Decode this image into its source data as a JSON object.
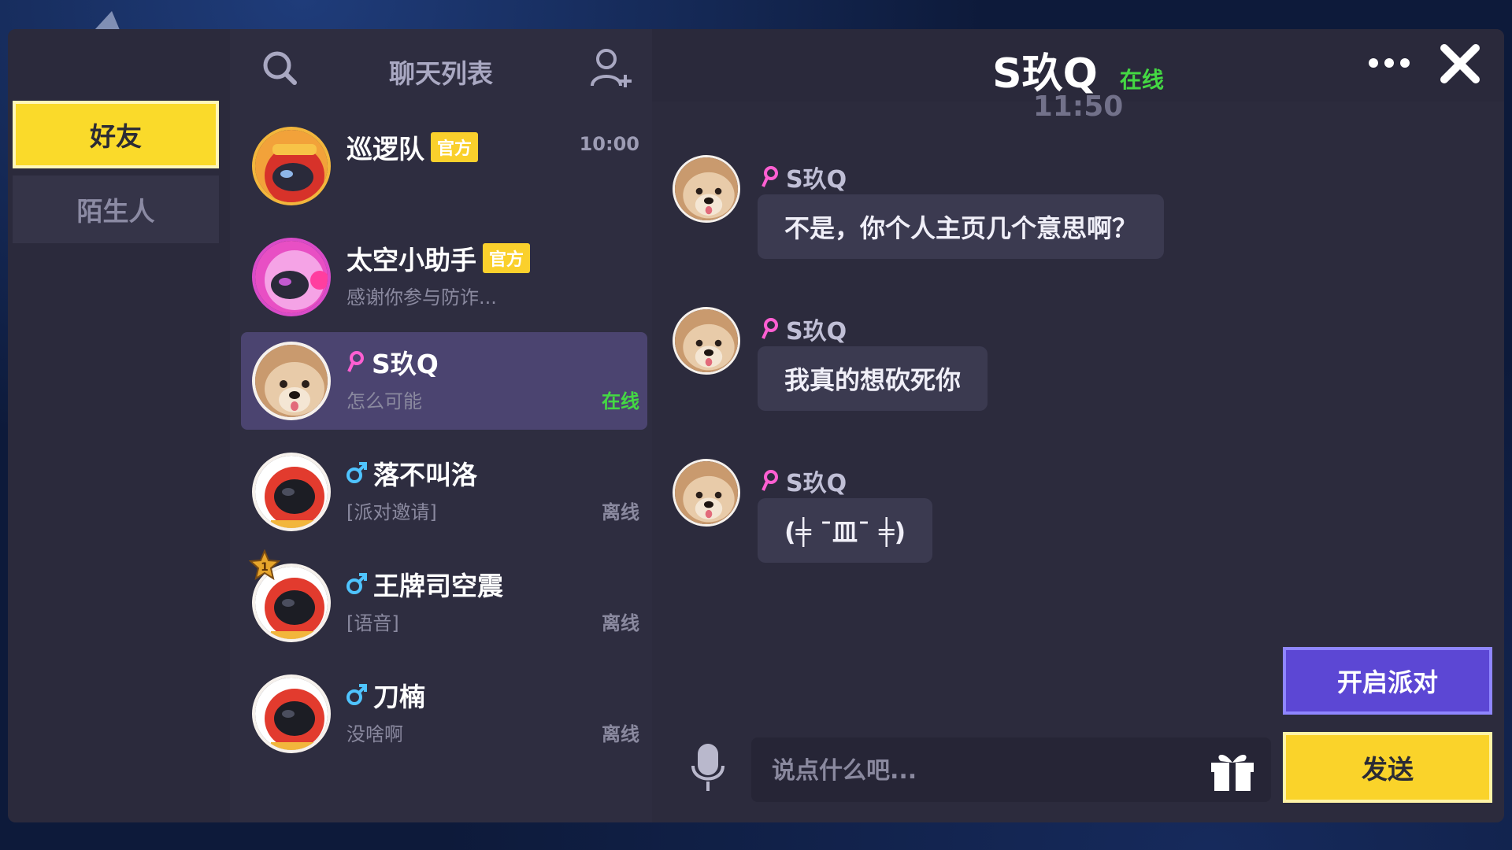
{
  "category": {
    "friends": "好友",
    "strangers": "陌生人"
  },
  "list_header": {
    "title": "聊天列表"
  },
  "chats": [
    {
      "name": "巡逻队",
      "badge": "官方",
      "preview": "",
      "meta": "10:00"
    },
    {
      "name": "太空小助手",
      "badge": "官方",
      "preview": "感谢你参与防诈...",
      "meta": ""
    },
    {
      "name": "S玖Q",
      "badge": "",
      "preview": "怎么可能",
      "meta": "在线"
    },
    {
      "name": "落不叫洛",
      "badge": "",
      "preview": "[派对邀请]",
      "meta": "离线"
    },
    {
      "name": "王牌司空震",
      "badge": "",
      "preview": "[语音]",
      "meta": "离线"
    },
    {
      "name": "刀楠",
      "badge": "",
      "preview": "没啥啊",
      "meta": "离线"
    }
  ],
  "conversation": {
    "name": "S玖Q",
    "status": "在线",
    "timestamp": "11:50",
    "messages": [
      {
        "sender": "S玖Q",
        "text": "不是，你个人主页几个意思啊？"
      },
      {
        "sender": "S玖Q",
        "text": "我真的想砍死你"
      },
      {
        "sender": "S玖Q",
        "text": "(╪ ¯皿¯ ╪)"
      }
    ],
    "input_placeholder": "说点什么吧...",
    "party_button": "开启派对",
    "send_button": "发送"
  },
  "colors": {
    "accent_yellow": "#fad32a",
    "accent_purple": "#5c47d4",
    "online_green": "#44d843",
    "female_pink": "#ff5fd2",
    "male_blue": "#4fc4ff"
  },
  "icons": [
    "search-icon",
    "add-friend-icon",
    "more-icon",
    "close-icon",
    "female-icon",
    "male-icon",
    "mic-icon",
    "gift-icon",
    "rank-badge-icon"
  ]
}
